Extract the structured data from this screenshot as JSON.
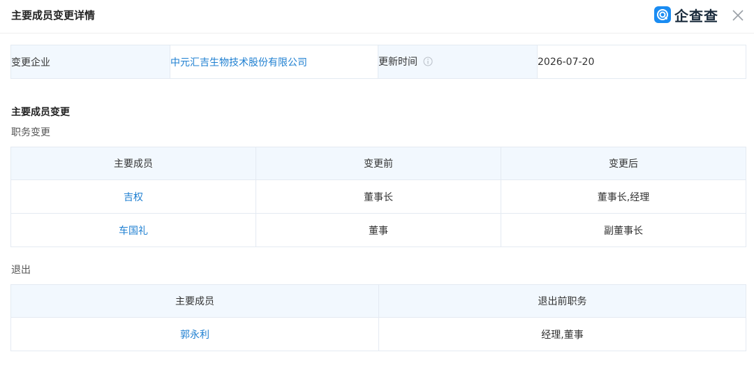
{
  "header": {
    "title": "主要成员变更详情",
    "brand": "企查查",
    "brand_color": "#1a8cf2"
  },
  "info": {
    "company_label": "变更企业",
    "company_value": "中元汇吉生物技术股份有限公司",
    "update_label": "更新时间",
    "update_value": "2026-07-20"
  },
  "section": {
    "title": "主要成员变更",
    "duty_change_label": "职务变更",
    "exit_label": "退出"
  },
  "duty_table": {
    "headers": [
      "主要成员",
      "变更前",
      "变更后"
    ],
    "rows": [
      {
        "member": "吉权",
        "before": "董事长",
        "after": "董事长,经理"
      },
      {
        "member": "车国礼",
        "before": "董事",
        "after": "副董事长"
      }
    ]
  },
  "exit_table": {
    "headers": [
      "主要成员",
      "退出前职务"
    ],
    "rows": [
      {
        "member": "郭永利",
        "duty": "经理,董事"
      }
    ]
  },
  "colors": {
    "link": "#1e7fd1",
    "header_bg": "#f2f8fe",
    "border": "#e4eaf2"
  }
}
